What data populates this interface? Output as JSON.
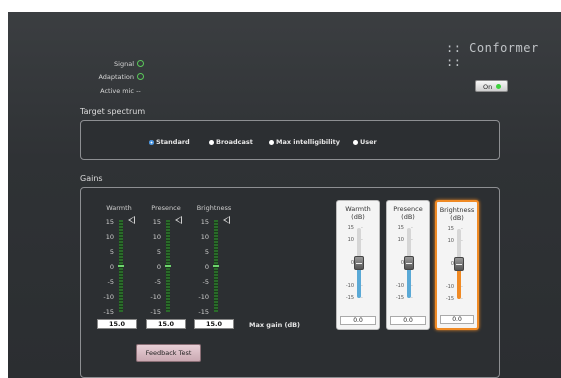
{
  "app": {
    "title": ":: Conformer ::"
  },
  "status": [
    {
      "label": "Signal",
      "indicator": "green-circle"
    },
    {
      "label": "Adaptation",
      "indicator": "green-circle"
    },
    {
      "label": "Active mic",
      "value": "--"
    }
  ],
  "power": {
    "label": "On",
    "led_color": "#3dd13d"
  },
  "target": {
    "heading": "Target spectrum",
    "options": [
      "Standard",
      "Broadcast",
      "Max intelligibility",
      "User"
    ],
    "selected": "Standard"
  },
  "gains": {
    "heading": "Gains",
    "meters": [
      {
        "name": "Warmth",
        "value": "15.0"
      },
      {
        "name": "Presence",
        "value": "15.0"
      },
      {
        "name": "Brightness",
        "value": "15.0"
      }
    ],
    "ticks": [
      "15",
      "10",
      "5",
      "0",
      "-5",
      "-10",
      "-15"
    ],
    "max_gain_label": "Max gain (dB)",
    "sliders": [
      {
        "line1": "Warmth",
        "line2": "(dB)",
        "value": "0.0",
        "gain": 0,
        "color": "#5aa9d6",
        "active": false
      },
      {
        "line1": "Presence",
        "line2": "(dB)",
        "value": "0.0",
        "gain": 0,
        "color": "#5aa9d6",
        "active": false
      },
      {
        "line1": "Brightness",
        "line2": "(dB)",
        "value": "0.0",
        "gain": 0,
        "color": "#f08a24",
        "active": true
      }
    ],
    "slider_ticks": [
      "15",
      "10",
      "0",
      "-10",
      "-15"
    ],
    "feedback_button": "Feedback Test"
  }
}
